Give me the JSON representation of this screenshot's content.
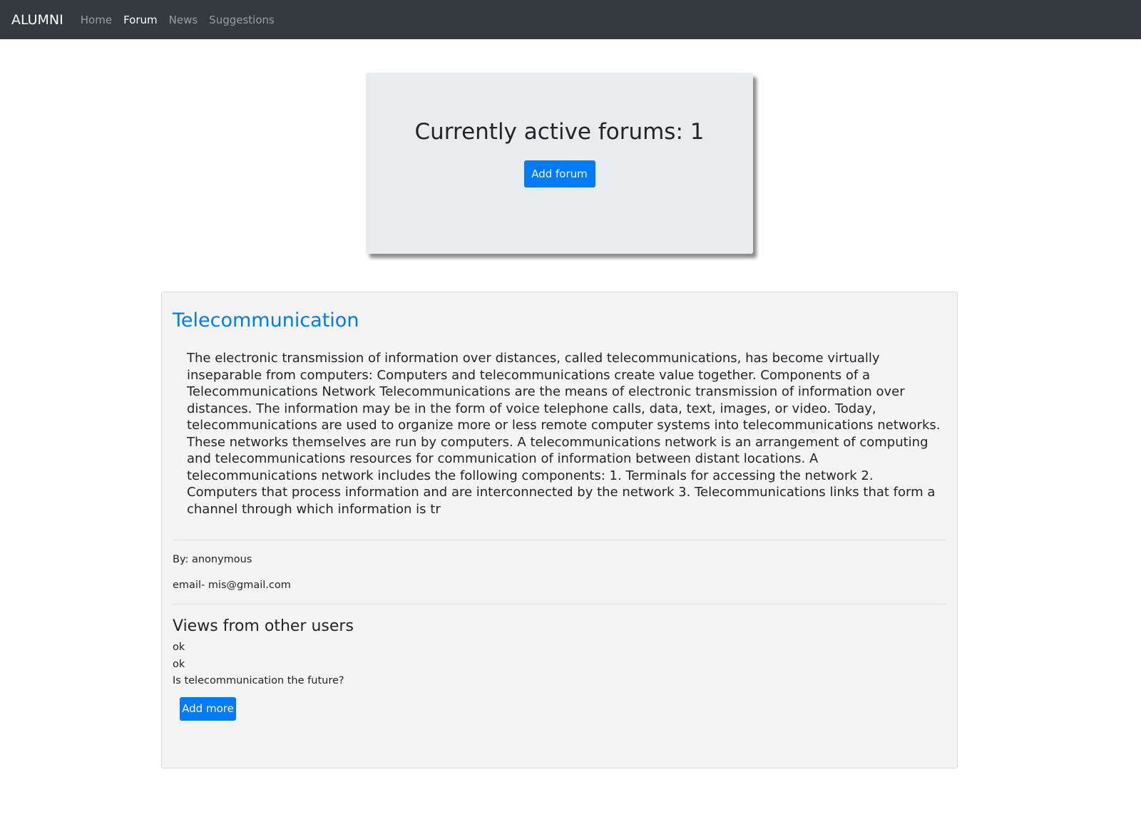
{
  "navbar": {
    "brand": "ALUMNI",
    "links": [
      {
        "label": "Home",
        "active": false
      },
      {
        "label": "Forum",
        "active": true
      },
      {
        "label": "News",
        "active": false
      },
      {
        "label": "Suggestions",
        "active": false
      }
    ]
  },
  "jumbotron": {
    "title": "Currently active forums: 1",
    "add_forum_label": "Add forum"
  },
  "forum": {
    "title": "Telecommunication",
    "body": "The electronic transmission of information over distances, called telecommunications, has become virtually inseparable from computers: Computers and telecommunications create value together. Components of a Telecommunications Network Telecommunications are the means of electronic transmission of information over distances. The information may be in the form of voice telephone calls, data, text, images, or video. Today, telecommunications are used to organize more or less remote computer systems into telecommunications networks. These networks themselves are run by computers. A telecommunications network is an arrangement of computing and telecommunications resources for communication of information between distant locations. A telecommunications network includes the following components: 1. Terminals for accessing the network 2. Computers that process information and are interconnected by the network 3. Telecommunications links that form a channel through which information is tr",
    "author": "By: anonymous",
    "email": "email- mis@gmail.com",
    "views_title": "Views from other users",
    "comments": [
      "ok",
      "ok",
      "Is telecommunication the future?"
    ],
    "add_more_label": "Add more"
  },
  "colors": {
    "navbar_bg": "#343a40",
    "primary": "#007bff",
    "jumbotron_bg": "#e9ecef",
    "card_bg": "#f4f4f4"
  }
}
